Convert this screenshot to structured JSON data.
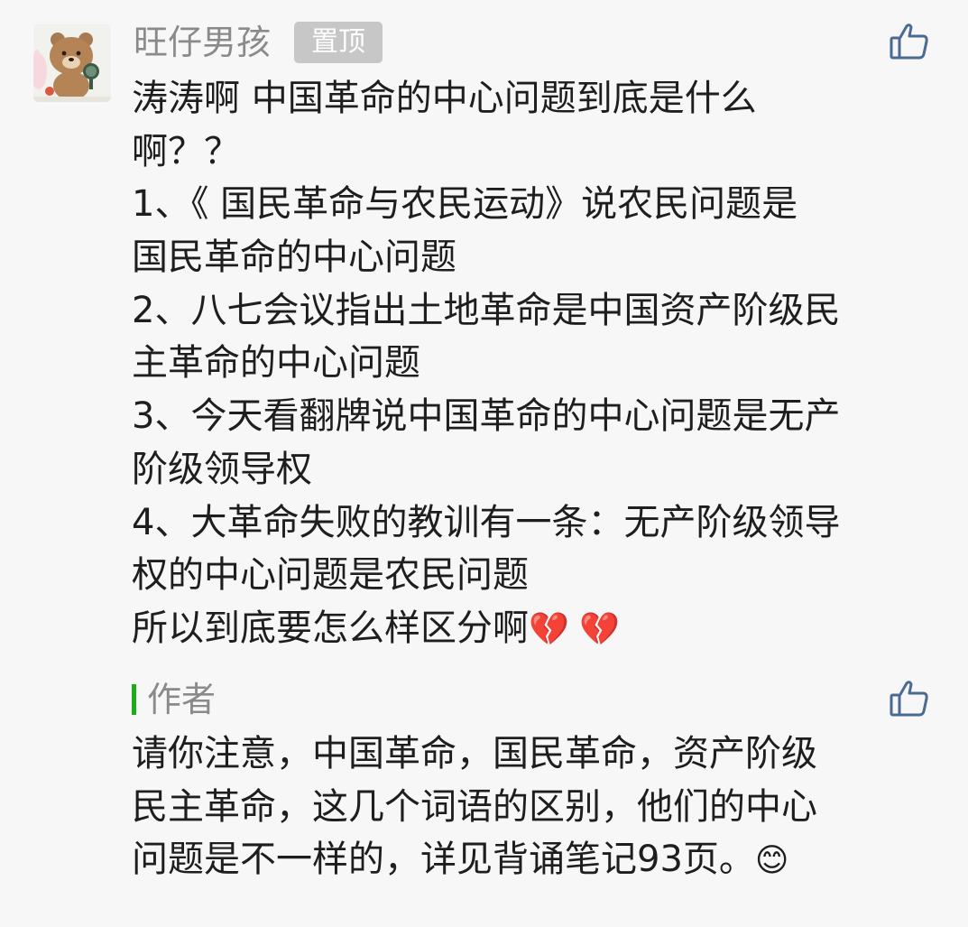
{
  "comment": {
    "nickname": "旺仔男孩",
    "pin_badge": "置顶",
    "like_icon": "thumbs-up-icon",
    "lines": [
      "涛涛啊 中国革命的中心问题到底是什么",
      "啊？？",
      "1、《 国民革命与农民运动》说农民问题是",
      "国民革命的中心问题",
      "2、八七会议指出土地革命是中国资产阶级民",
      "主革命的中心问题",
      "3、今天看翻牌说中国革命的中心问题是无产",
      "阶级领导权",
      "4、大革命失败的教训有一条：无产阶级领导",
      "权的中心问题是农民问题",
      "所以到底要怎么样区分啊"
    ],
    "trailing_emoji": "💔 💔"
  },
  "reply": {
    "author_label": "作者",
    "accent_color": "#1aad19",
    "like_icon": "thumbs-up-icon",
    "lines": [
      "请你注意，中国革命，国民革命，资产阶级",
      "民主革命，这几个词语的区别，他们的中心",
      "问题是不一样的，详见背诵笔记93页。"
    ],
    "trailing_emoji": "😊"
  }
}
